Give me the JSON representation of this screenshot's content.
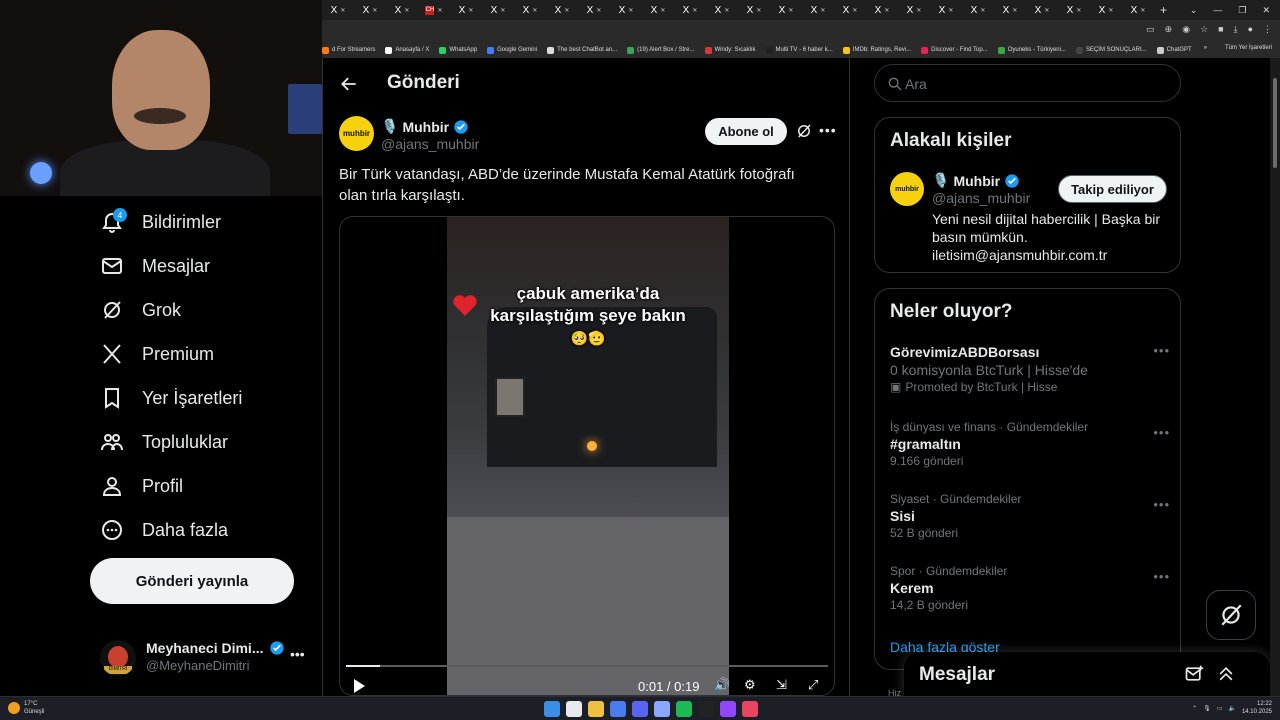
{
  "browser": {
    "tab_count": 26,
    "tab_labels": [
      "X",
      "X",
      "X",
      "CH",
      "X",
      "X",
      "X",
      "X",
      "X",
      "X",
      "X",
      "X",
      "X",
      "X",
      "X",
      "X",
      "X",
      "X",
      "X",
      "X",
      "X",
      "X",
      "X",
      "X",
      "X",
      "X"
    ],
    "bookmarks": [
      "d For Streamers",
      "Anasayfa / X",
      "WhatsApp",
      "Google Gemini",
      "The best ChatBot an...",
      "(19) Alert Box / Stre...",
      "Windy: Sıcaklık",
      "Multi TV - 6 haber k...",
      "IMDb: Ratings, Revi...",
      "Discover - Find Top...",
      "Oyuneks - Türkiyeni...",
      "SEÇİM SONUÇLARI...",
      "ChatGPT"
    ],
    "bookmarks_overflow": "»",
    "bookmarks_folder": "Tüm Yer İşaretleri",
    "bookmark_colors": [
      "#ff7a1a",
      "#ffffff",
      "#25d366",
      "#4b7bf5",
      "#dddddd",
      "#3ea25d",
      "#d23b3b",
      "#222222",
      "#f5c518",
      "#e0245e",
      "#39a845",
      "#444444",
      "#cccccc"
    ]
  },
  "nav": {
    "items": [
      {
        "label": "Bildirimler",
        "icon": "bell-icon",
        "badge": "4"
      },
      {
        "label": "Mesajlar",
        "icon": "mail-icon"
      },
      {
        "label": "Grok",
        "icon": "grok-icon"
      },
      {
        "label": "Premium",
        "icon": "x-logo-icon"
      },
      {
        "label": "Yer İşaretleri",
        "icon": "bookmark-icon"
      },
      {
        "label": "Topluluklar",
        "icon": "communities-icon"
      },
      {
        "label": "Profil",
        "icon": "profile-icon"
      },
      {
        "label": "Daha fazla",
        "icon": "more-circle-icon"
      }
    ],
    "post_button": "Gönderi yayınla",
    "account": {
      "name": "Meyhaneci Dimi...",
      "handle": "@MeyhaneDimitri",
      "avatar_text": "DIMITRI"
    }
  },
  "main": {
    "header_title": "Gönderi",
    "tweet": {
      "avatar_text": "muhbir",
      "name": "Muhbir",
      "handle": "@ajans_muhbir",
      "follow_label": "Abone ol",
      "text": "Bir Türk vatandaşı, ABD’de üzerinde Mustafa Kemal Atatürk fotoğrafı olan tırla karşılaştı.",
      "video": {
        "caption_line1": "çabuk amerika’da",
        "caption_line2": "karşılaştığım şeye bakın",
        "caption_emoji": "🥺🫡",
        "time": "0:01 / 0:19",
        "progress": 0.07
      }
    }
  },
  "right": {
    "search_placeholder": "Ara",
    "related": {
      "title": "Alakalı kişiler",
      "avatar_text": "muhbir",
      "name": "Muhbir",
      "handle": "@ajans_muhbir",
      "button": "Takip ediliyor",
      "bio_line1": "Yeni nesil dijital habercilik | Başka bir",
      "bio_line2": "basın mümkün.",
      "bio_line3": "iletisim@ajansmuhbir.com.tr"
    },
    "trends": {
      "title": "Neler oluyor?",
      "items": [
        {
          "title": "GörevimizABDBorsası",
          "sub": "0 komisyonla BtcTurk | Hisse'de",
          "promo": "Promoted by BtcTurk | Hisse"
        },
        {
          "context": "İş dünyası ve finans · Gündemdekiler",
          "title": "#gramaltın",
          "count": "9.166 gönderi"
        },
        {
          "context": "Siyaset · Gündemdekiler",
          "title": "Sisi",
          "count": "52 B gönderi"
        },
        {
          "context": "Spor · Gündemdekiler",
          "title": "Kerem",
          "count": "14,2 B gönderi"
        }
      ],
      "show_more": "Daha fazla göster"
    },
    "messages_drawer": "Mesajlar",
    "footer_partial": "Hiz"
  },
  "taskbar": {
    "weather_temp": "17°C",
    "weather_desc": "Güneşli",
    "time": "12:22",
    "date": "14.10.2025",
    "app_colors": [
      "#3a8ee6",
      "#e8eaed",
      "#f0c040",
      "#4a7cf0",
      "#5865f2",
      "#8aa8ff",
      "#1db954",
      "#222222",
      "#9146ff",
      "#e94560"
    ]
  }
}
